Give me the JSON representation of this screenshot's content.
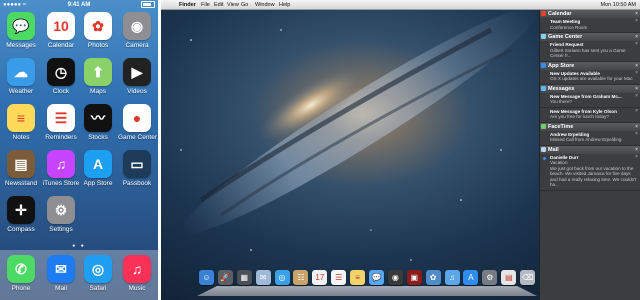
{
  "phone": {
    "status": {
      "carrier": "●●●●● ≈",
      "time": "9:41 AM"
    },
    "apps": [
      {
        "label": "Messages",
        "glyph": "💬",
        "color": "#4cd964"
      },
      {
        "label": "Calendar",
        "glyph": "10",
        "color": "#ffffff"
      },
      {
        "label": "Photos",
        "glyph": "✿",
        "color": "#ffffff"
      },
      {
        "label": "Camera",
        "glyph": "◉",
        "color": "#8e8e93"
      },
      {
        "label": "Weather",
        "glyph": "☁",
        "color": "#3a9be8"
      },
      {
        "label": "Clock",
        "glyph": "◷",
        "color": "#111111"
      },
      {
        "label": "Maps",
        "glyph": "⬆",
        "color": "#8bd16a"
      },
      {
        "label": "Videos",
        "glyph": "▶",
        "color": "#222222"
      },
      {
        "label": "Notes",
        "glyph": "≡",
        "color": "#ffd95a"
      },
      {
        "label": "Reminders",
        "glyph": "☰",
        "color": "#ffffff"
      },
      {
        "label": "Stocks",
        "glyph": "〰",
        "color": "#111111"
      },
      {
        "label": "Game Center",
        "glyph": "●",
        "color": "#ffffff"
      },
      {
        "label": "Newsstand",
        "glyph": "▤",
        "color": "#7a5c3a"
      },
      {
        "label": "iTunes Store",
        "glyph": "♫",
        "color": "#c644fc"
      },
      {
        "label": "App Store",
        "glyph": "A",
        "color": "#1ea0f2"
      },
      {
        "label": "Passbook",
        "glyph": "▭",
        "color": "#1e3c5a"
      },
      {
        "label": "Compass",
        "glyph": "✛",
        "color": "#111111"
      },
      {
        "label": "Settings",
        "glyph": "⚙",
        "color": "#8e8e93"
      }
    ],
    "page_dots": "● ●",
    "dock": [
      {
        "label": "Phone",
        "glyph": "✆",
        "color": "#4cd964"
      },
      {
        "label": "Mail",
        "glyph": "✉",
        "color": "#1d7cf2"
      },
      {
        "label": "Safari",
        "glyph": "◎",
        "color": "#1e9ff2"
      },
      {
        "label": "Music",
        "glyph": "♫",
        "color": "#fc3158"
      }
    ]
  },
  "mac": {
    "menubar": {
      "apple": "",
      "items": [
        "Finder",
        "File",
        "Edit",
        "View",
        "Go",
        "Window",
        "Help"
      ],
      "clock": "Mon 10:50 AM"
    },
    "notification_center": [
      {
        "section": "Calendar",
        "icon_color": "#e8402d",
        "items": [
          {
            "title": "Team Meeting",
            "body": "Conference Room"
          }
        ]
      },
      {
        "section": "Game Center",
        "icon_color": "#7bd3ff",
        "items": [
          {
            "title": "Friend Request",
            "body": "Gilbert Soriano has sent you a Game Center fr..."
          }
        ]
      },
      {
        "section": "App Store",
        "icon_color": "#2f8df0",
        "items": [
          {
            "title": "New Updates Available",
            "body": "OS X updates are available for your Mac"
          }
        ]
      },
      {
        "section": "Messages",
        "icon_color": "#5fb8f4",
        "items": [
          {
            "title": "New Message from Graham Mc...",
            "body": "You there?"
          },
          {
            "title": "New Message from Kyle Olson",
            "body": "Are you free for lunch today?"
          }
        ]
      },
      {
        "section": "FaceTime",
        "icon_color": "#6fd06a",
        "items": [
          {
            "title": "Andrew Erpelding",
            "body": "Missed Call from Andrew Erpelding"
          }
        ]
      },
      {
        "section": "Mail",
        "icon_color": "#bcd2ec",
        "items": [
          {
            "title": "Danielle Durr",
            "body": "Vacation\nWe just got back from our vacation to the beach. We visited Jamaica for five days and had a really relaxing time. We couldn't ha..."
          }
        ]
      }
    ],
    "dock": [
      {
        "name": "finder",
        "glyph": "☺",
        "color": "#3b82d6"
      },
      {
        "name": "launchpad",
        "glyph": "🚀",
        "color": "#5a5f68"
      },
      {
        "name": "mission-control",
        "glyph": "▦",
        "color": "#4a4f58"
      },
      {
        "name": "mail",
        "glyph": "✉",
        "color": "#9fb9d8"
      },
      {
        "name": "safari",
        "glyph": "◎",
        "color": "#3aa0e8"
      },
      {
        "name": "contacts",
        "glyph": "☷",
        "color": "#c8a46a"
      },
      {
        "name": "calendar",
        "glyph": "17",
        "color": "#f2f2f2"
      },
      {
        "name": "reminders",
        "glyph": "☰",
        "color": "#f5f5f5"
      },
      {
        "name": "notes",
        "glyph": "≡",
        "color": "#f0d36a"
      },
      {
        "name": "messages",
        "glyph": "💬",
        "color": "#58a6f0"
      },
      {
        "name": "facetime",
        "glyph": "◉",
        "color": "#3a3a3a"
      },
      {
        "name": "photo-booth",
        "glyph": "▣",
        "color": "#8b1d1d"
      },
      {
        "name": "iphoto",
        "glyph": "✿",
        "color": "#4f8cc9"
      },
      {
        "name": "itunes",
        "glyph": "♫",
        "color": "#5aa6e8"
      },
      {
        "name": "app-store",
        "glyph": "A",
        "color": "#2d8ef0"
      },
      {
        "name": "system-preferences",
        "glyph": "⚙",
        "color": "#777c84"
      },
      {
        "name": "documents",
        "glyph": "▤",
        "color": "#e6e6e6"
      },
      {
        "name": "trash",
        "glyph": "⌫",
        "color": "#b4b8bf"
      }
    ]
  }
}
